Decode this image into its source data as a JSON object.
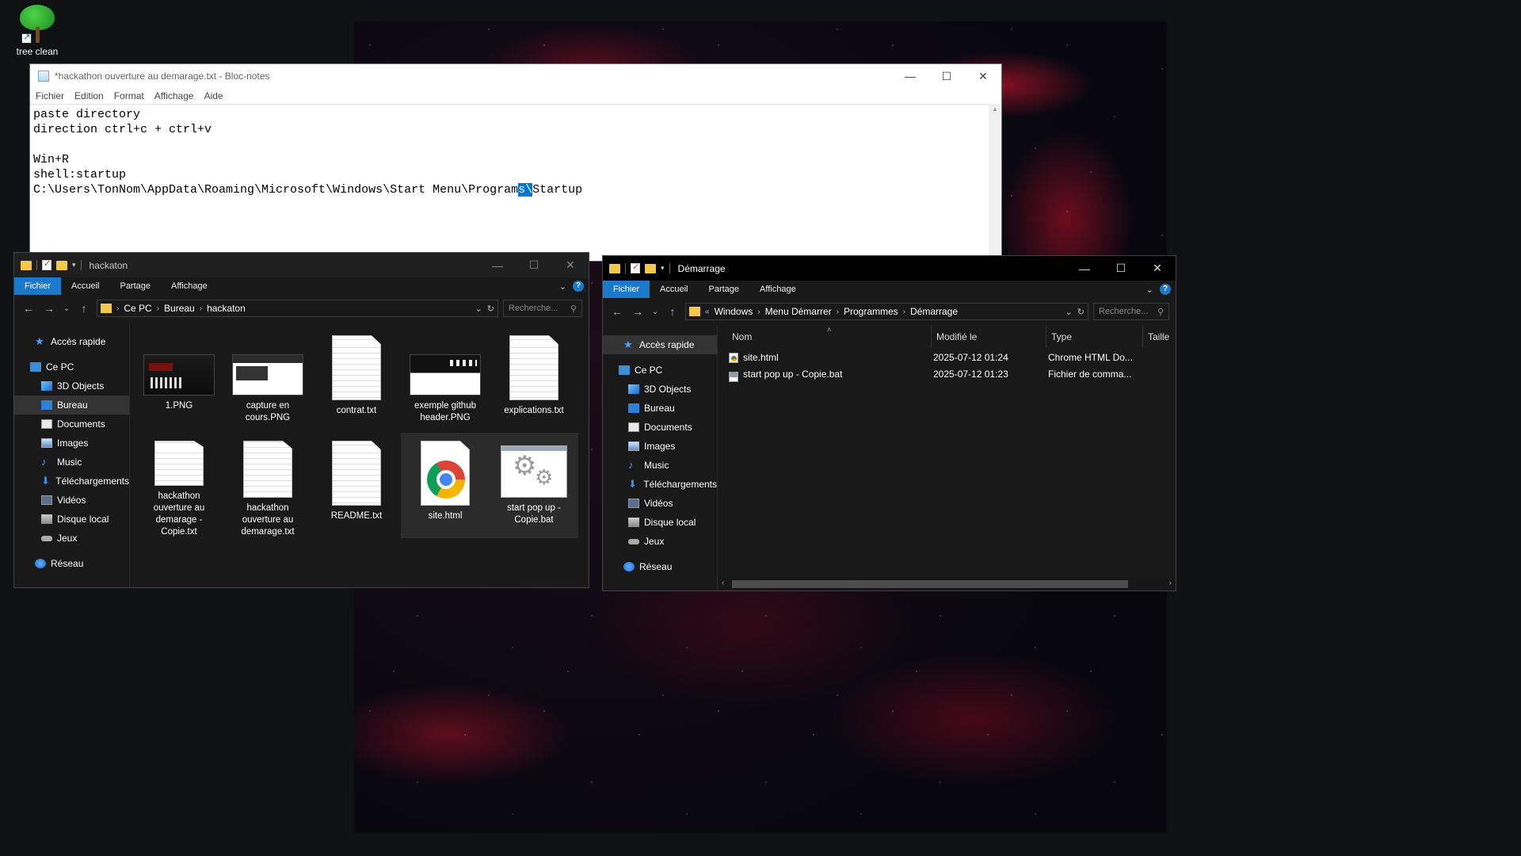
{
  "desktop": {
    "icon_label": "tree clean"
  },
  "notepad": {
    "title": "*hackathon ouverture au demarage.txt - Bloc-notes",
    "menu": [
      "Fichier",
      "Edition",
      "Format",
      "Affichage",
      "Aide"
    ],
    "lines": [
      "paste directory",
      "direction ctrl+c + ctrl+v",
      "",
      "Win+R",
      "shell:startup"
    ],
    "path_before": "C:\\Users\\TonNom\\AppData\\Roaming\\Microsoft\\Windows\\Start Menu\\Program",
    "path_selected": "s\\",
    "path_after": "Startup"
  },
  "explorer_left": {
    "title": "hackaton",
    "ribbon_tabs": [
      "Fichier",
      "Accueil",
      "Partage",
      "Affichage"
    ],
    "breadcrumb": [
      "Ce PC",
      "Bureau",
      "hackaton"
    ],
    "search_placeholder": "Recherche...",
    "nav": [
      "Accès rapide",
      "Ce PC",
      "3D Objects",
      "Bureau",
      "Documents",
      "Images",
      "Music",
      "Téléchargements",
      "Vidéos",
      "Disque local",
      "Jeux",
      "Réseau"
    ],
    "files": [
      "1.PNG",
      "capture en cours.PNG",
      "contrat.txt",
      "exemple github header.PNG",
      "explications.txt",
      "hackathon ouverture au demarage - Copie.txt",
      "hackathon ouverture au demarage.txt",
      "README.txt",
      "site.html",
      "start pop up - Copie.bat"
    ]
  },
  "explorer_right": {
    "title": "Démarrage",
    "ribbon_tabs": [
      "Fichier",
      "Accueil",
      "Partage",
      "Affichage"
    ],
    "breadcrumb_prefix": "«",
    "breadcrumb": [
      "Windows",
      "Menu Démarrer",
      "Programmes",
      "Démarrage"
    ],
    "search_placeholder": "Recherche...",
    "nav": [
      "Accès rapide",
      "Ce PC",
      "3D Objects",
      "Bureau",
      "Documents",
      "Images",
      "Music",
      "Téléchargements",
      "Vidéos",
      "Disque local",
      "Jeux",
      "Réseau"
    ],
    "columns": [
      "Nom",
      "Modifié le",
      "Type",
      "Taille"
    ],
    "rows": [
      {
        "name": "site.html",
        "modified": "2025-07-12 01:24",
        "type": "Chrome HTML Do..."
      },
      {
        "name": "start pop up - Copie.bat",
        "modified": "2025-07-12 01:23",
        "type": "Fichier de comma..."
      }
    ]
  },
  "colors": {
    "accent": "#1979ca",
    "selection": "#0078d7",
    "explorer_bg": "#191919"
  }
}
